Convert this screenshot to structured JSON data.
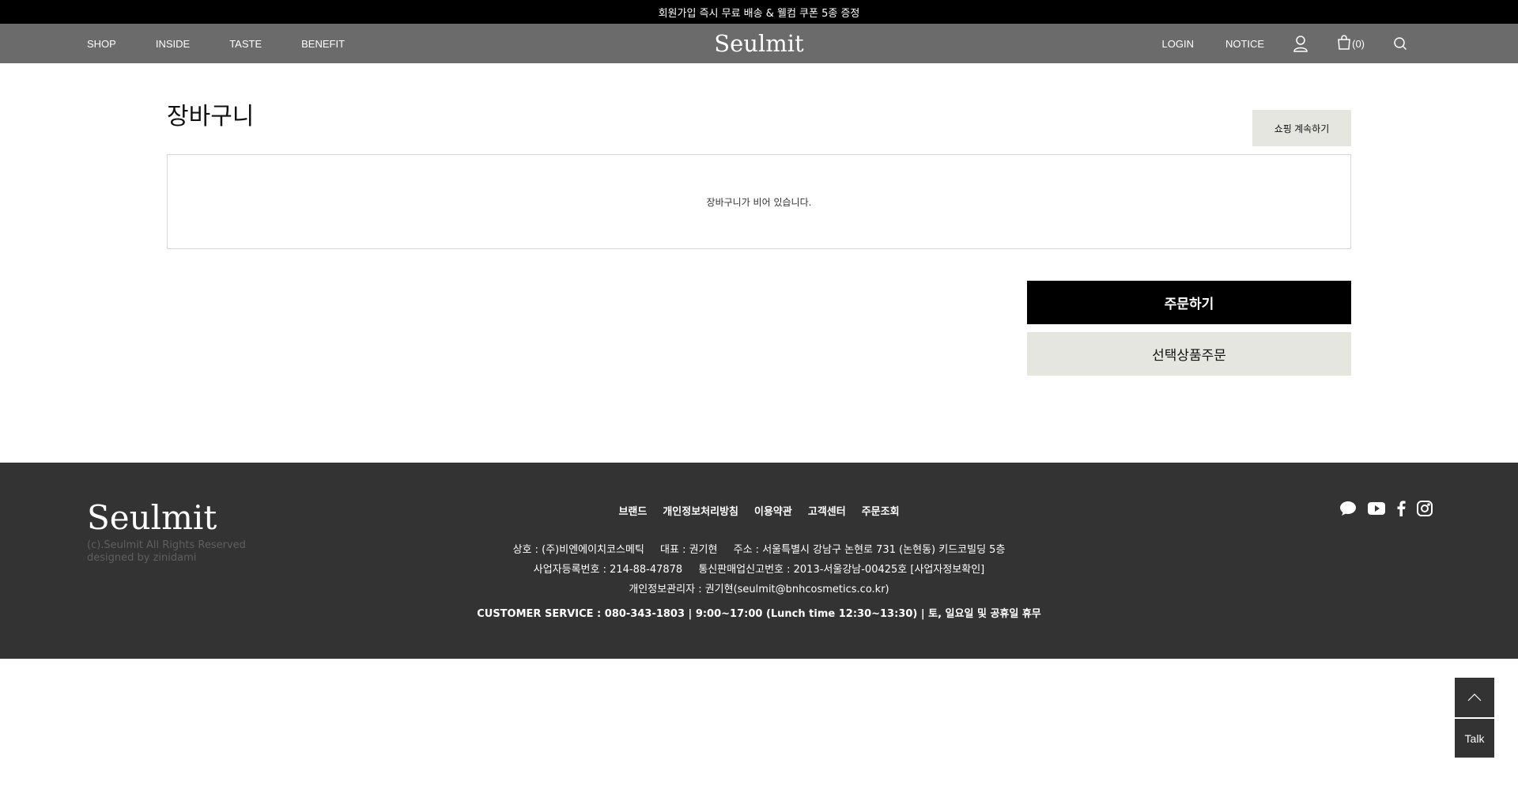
{
  "topbar": {
    "text": "회원가입 즉시 무료 배송 & 웰컴 쿠폰 5종 증정"
  },
  "header": {
    "nav_left": [
      "SHOP",
      "INSIDE",
      "TASTE",
      "BENEFIT"
    ],
    "logo": "Seulmit",
    "login": "LOGIN",
    "notice": "NOTICE",
    "cart_count": "(0)",
    "icons": [
      "user-icon",
      "cart-icon",
      "search-icon"
    ]
  },
  "cart": {
    "title": "장바구니",
    "continue_label": "쇼핑 계속하기",
    "empty_message": "장바구니가 비어 있습니다.",
    "order_label": "주문하기",
    "select_order_label": "선택상품주문"
  },
  "footer": {
    "logo": "Seulmit",
    "copyright": "(c).Seulmit All Rights Reserved",
    "designed_by": "designed by zinidami",
    "links": [
      "브랜드",
      "개인정보처리방침",
      "이용약관",
      "고객센터",
      "주문조회"
    ],
    "info_line1": [
      "상호 : (주)비엔에이치코스메틱",
      "대표 : 권기현",
      "주소 : 서울특별시 강남구 논현로 731 (논현동) 키드코빌딩 5층"
    ],
    "info_line2": [
      "사업자등록번호 : 214-88-47878",
      "통신판매업신고번호 : 2013-서울강남-00425호 [사업자정보확인]"
    ],
    "info_line3": "개인정보관리자 : 권기현(seulmit@bnhcosmetics.co.kr)",
    "customer_service": "CUSTOMER SERVICE : 080-343-1803  |  9:00~17:00 (Lunch time 12:30~13:30)  |  토, 일요일 및 공휴일 휴무",
    "social": [
      "talk-icon",
      "youtube-icon",
      "facebook-icon",
      "instagram-icon"
    ]
  },
  "floating": {
    "talk_label": "Talk"
  },
  "colors": {
    "header_bg": "#6b6b6b",
    "footer_bg": "#333333",
    "button_light": "#e6e6e1",
    "button_dark": "#000000"
  }
}
